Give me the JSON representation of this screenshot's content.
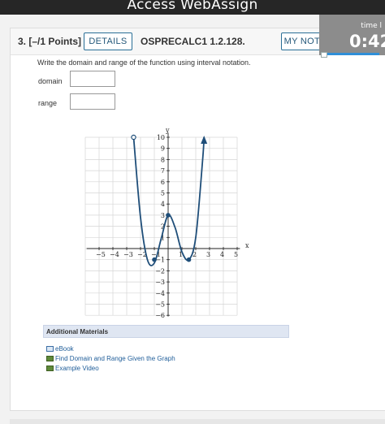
{
  "app": {
    "title": "Access WebAssign"
  },
  "timer": {
    "label": "time l",
    "value": "0:42"
  },
  "question": {
    "number": "3.",
    "points": "[–/1 Points]",
    "number_points": "3.  [–/1 Points]",
    "details_label": "DETAILS",
    "code": "OSPRECALC1 1.2.128.",
    "mynotes_label": "MY NOTES",
    "prompt": "Write the domain and range of the function using interval notation.",
    "fields": [
      {
        "label": "domain",
        "value": ""
      },
      {
        "label": "range",
        "value": ""
      }
    ]
  },
  "graph": {
    "x_axis_label": "x",
    "y_axis_label": "y",
    "x_tick_labels": [
      "−5",
      "−4",
      "−3",
      "−2",
      "−1",
      "1",
      "2",
      "3",
      "4",
      "5"
    ],
    "y_tick_labels": [
      "10",
      "9",
      "8",
      "7",
      "6",
      "5",
      "4",
      "3",
      "2",
      "1",
      "−1",
      "−2",
      "−3",
      "−4",
      "−5",
      "−6"
    ]
  },
  "chart_data": {
    "type": "line",
    "xlim": [
      -5,
      5
    ],
    "ylim": [
      -6,
      10
    ],
    "grid": true,
    "xlabel": "x",
    "ylabel": "y",
    "series": [
      {
        "x": [
          -2.5,
          -2,
          -1.5,
          -1,
          -0.5,
          0,
          0.5,
          1,
          1.5,
          2,
          2.5,
          2.6
        ],
        "y": [
          10,
          2.8,
          -1,
          -1.3,
          0.9,
          3,
          1.9,
          -0.3,
          -1,
          1,
          8,
          10
        ],
        "start_point": "open circle at (-2.5, 10)",
        "end": "arrow continuing upward"
      }
    ],
    "marked_points": [
      {
        "x": -1,
        "y": -1
      },
      {
        "x": 0,
        "y": 3
      },
      {
        "x": 1.5,
        "y": -1
      }
    ]
  },
  "additional_materials": {
    "title": "Additional Materials",
    "links": [
      {
        "label": "eBook",
        "icon": "book-icon"
      },
      {
        "label": "Find Domain and Range Given the Graph",
        "icon": "video-icon"
      },
      {
        "label": "Example Video",
        "icon": "video-icon"
      }
    ]
  }
}
